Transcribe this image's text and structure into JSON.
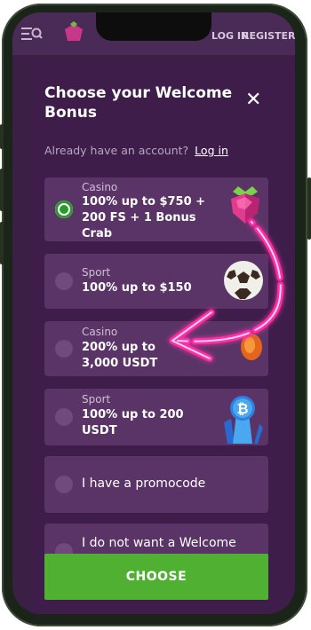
{
  "topbar": {
    "login_label": "LOG IN",
    "register_label": "REGISTER"
  },
  "modal": {
    "title": "Choose your Welcome Bonus",
    "close_icon": "close-icon",
    "already_text": "Already have an account?",
    "login_link": "Log in",
    "options": [
      {
        "type": "Casino",
        "text": "100% up to $750 + 200 FS + 1 Bonus Crab",
        "selected": true,
        "icon": "raspberry-gem-icon"
      },
      {
        "type": "Sport",
        "text": "100% up to $150",
        "selected": false,
        "icon": "soccer-ball-icon"
      },
      {
        "type": "Casino",
        "text": "200% up to 3,000 USDT",
        "selected": false,
        "icon": "orange-coin-icon"
      },
      {
        "type": "Sport",
        "text": "100% up to 200 USDT",
        "selected": false,
        "icon": "bitcoin-crystal-icon"
      },
      {
        "type": "",
        "text": "I have a promocode",
        "selected": false
      },
      {
        "type": "",
        "text": "I do not want a Welcome Bonus",
        "selected": false
      }
    ],
    "choose_label": "CHOOSE"
  },
  "annotation": {
    "color": "#ff2fa8",
    "icon": "curved-arrow-icon"
  },
  "colors": {
    "accent_green": "#4fb031",
    "modal_bg": "#3e1d4a",
    "card_bg": "#5a3466"
  }
}
